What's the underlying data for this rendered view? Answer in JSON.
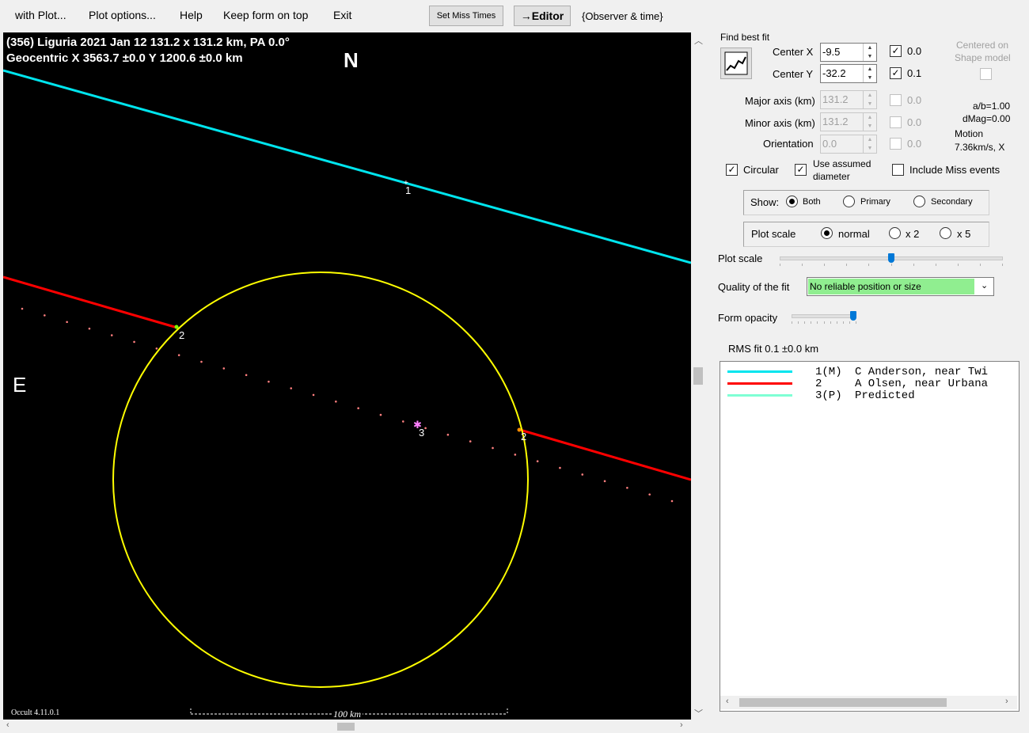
{
  "menu": {
    "with_plot": "with Plot...",
    "plot_options": "Plot options...",
    "help": "Help",
    "keep_on_top": "Keep form on top",
    "exit": "Exit",
    "set_miss_times": "Set Miss Times",
    "editor": "→Editor",
    "observer_time": "{Observer & time}"
  },
  "plot": {
    "header_line1": "(356) Liguria  2021 Jan 12   131.2 x 131.2 km,  PA 0.0°",
    "header_line2": "Geocentric  X  3563.7 ±0.0  Y  1200.6 ±0.0 km",
    "north": "N",
    "east": "E",
    "version": "Occult 4.11.0.1",
    "scale_label": "100 km",
    "chord_labels": [
      "1",
      "2",
      "2",
      "3"
    ],
    "colors": {
      "chord1": "#00e5ee",
      "chord2": "#ff0000",
      "ellipse": "#ffff00",
      "predicted_dots": "#ff7f7f"
    }
  },
  "panel": {
    "find_best_fit": "Find best fit",
    "center_x_label": "Center X",
    "center_x_value": "-9.5",
    "center_x_step": "0.0",
    "center_y_label": "Center Y",
    "center_y_value": "-32.2",
    "center_y_step": "0.1",
    "centered_on": "Centered on",
    "shape_model": "Shape model",
    "major_label": "Major axis (km)",
    "major_value": "131.2",
    "major_step": "0.0",
    "minor_label": "Minor axis (km)",
    "minor_value": "131.2",
    "minor_step": "0.0",
    "orient_label": "Orientation",
    "orient_value": "0.0",
    "orient_step": "0.0",
    "ab_ratio": "a/b=1.00",
    "dmag": "dMag=0.00",
    "motion_label": "Motion",
    "motion_value": "7.36km/s, X",
    "circular": "Circular",
    "use_assumed_1": "Use assumed",
    "use_assumed_2": "diameter",
    "include_miss": "Include Miss events",
    "show_label": "Show:",
    "show_both": "Both",
    "show_primary": "Primary",
    "show_secondary": "Secondary",
    "plot_scale_group": "Plot scale",
    "scale_normal": "normal",
    "scale_x2": "x 2",
    "scale_x5": "x 5",
    "plot_scale_slider_label": "Plot scale",
    "plot_scale_level": 0.5,
    "quality_label": "Quality of the fit",
    "quality_value": "No reliable position or size",
    "quality_color": "#90ee90",
    "form_opacity_label": "Form opacity",
    "form_opacity_level": 1.0,
    "rms": "RMS fit 0.1 ±0.0 km"
  },
  "legend": [
    {
      "id": "1(M)",
      "text": "C Anderson, near Twi",
      "color": "#00e5ee"
    },
    {
      "id": "2",
      "text": "A Olsen, near Urbana",
      "color": "#ff0000"
    },
    {
      "id": "3(P)",
      "text": "Predicted",
      "color": "#7fffd4"
    }
  ]
}
